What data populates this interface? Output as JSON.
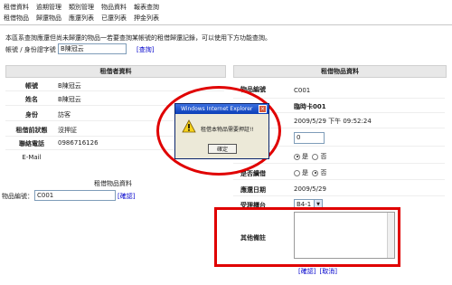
{
  "menu": {
    "row1": [
      "租借資料",
      "逾期管理",
      "類別管理",
      "物品資料",
      "報表查詢"
    ],
    "row2": [
      "租借物品",
      "歸還物品",
      "應還列表",
      "已還列表",
      "押金列表"
    ]
  },
  "notice": "本區系查詢應還但尚未歸還的物品一若要查詢某帳號的租借歸還記錄，可以使用下方功能查詢。",
  "account_search": {
    "label": "帳號 / 身份證字號",
    "value": "B陳冠云",
    "link": "[查詢]"
  },
  "borrower": {
    "header": "租借者資料",
    "rows": [
      {
        "label": "帳號",
        "value": "B陳冠云"
      },
      {
        "label": "姓名",
        "value": "B陳冠云"
      },
      {
        "label": "身份",
        "value": "訪客"
      },
      {
        "label": "租借前狀態",
        "value": "沒押証"
      },
      {
        "label": "聯絡電話",
        "value": "0986716126"
      },
      {
        "label": "E-Mail",
        "value": ""
      }
    ]
  },
  "borrow_item": {
    "title": "租借物品資料",
    "label": "物品編號：",
    "value": "C001",
    "link": "[確認]"
  },
  "item": {
    "header": "租借物品資料",
    "code_label": "物品編號",
    "code": "C001",
    "name": "臨時卡001",
    "datetime": "2009/5/29 下午 09:52:24",
    "quantity": "0",
    "yes": "是",
    "no": "否",
    "deposit_label": "是否續借",
    "return_date_label": "應還日期",
    "return_date": "2009/5/29",
    "counter_label": "受理櫃台",
    "counter": "B4-1",
    "remarks_label": "其他備註"
  },
  "dialog": {
    "title": "Windows Internet Explorer",
    "message": "租借本物品需要押証!!",
    "ok": "確定"
  },
  "actions": {
    "confirm": "[確認]",
    "cancel": "[取消]"
  },
  "colors": {
    "highlight": "#e00000",
    "link": "#0000cc",
    "titlebar": "#0c3fb8"
  }
}
